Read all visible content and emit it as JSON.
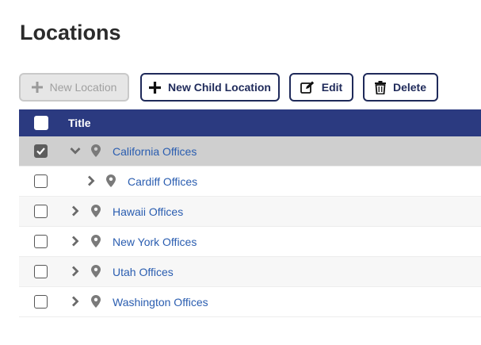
{
  "page": {
    "title": "Locations"
  },
  "toolbar": {
    "new_location": "New Location",
    "new_child_location": "New Child Location",
    "edit": "Edit",
    "delete": "Delete"
  },
  "grid": {
    "header": {
      "title": "Title"
    },
    "rows": [
      {
        "label": "California Offices",
        "selected": true,
        "expanded": true,
        "level": 0
      },
      {
        "label": "Cardiff Offices",
        "selected": false,
        "expanded": false,
        "level": 1
      },
      {
        "label": "Hawaii Offices",
        "selected": false,
        "expanded": false,
        "level": 0
      },
      {
        "label": "New York Offices",
        "selected": false,
        "expanded": false,
        "level": 0
      },
      {
        "label": "Utah Offices",
        "selected": false,
        "expanded": false,
        "level": 0
      },
      {
        "label": "Washington Offices",
        "selected": false,
        "expanded": false,
        "level": 0
      }
    ]
  },
  "colors": {
    "header_bg": "#2b3a80",
    "link": "#2a5db0",
    "selected_row": "#cfcfcf",
    "button_border": "#1f2a5a"
  }
}
